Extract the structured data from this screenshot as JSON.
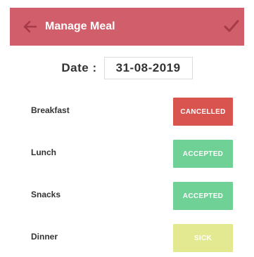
{
  "appbar": {
    "title": "Manage Meal",
    "back_icon": "arrow-left-icon",
    "confirm_icon": "checkmark-icon",
    "color": "#d15e6b"
  },
  "date": {
    "label": "Date :",
    "value": "31-08-2019"
  },
  "meals": [
    {
      "label": "Breakfast",
      "status": "CANCELLED",
      "color": "#d9534f"
    },
    {
      "label": "Lunch",
      "status": "ACCEPTED",
      "color": "#6fd195"
    },
    {
      "label": "Snacks",
      "status": "ACCEPTED",
      "color": "#6fd195"
    },
    {
      "label": "Dinner",
      "status": "SICK",
      "color": "#e3e990"
    }
  ]
}
